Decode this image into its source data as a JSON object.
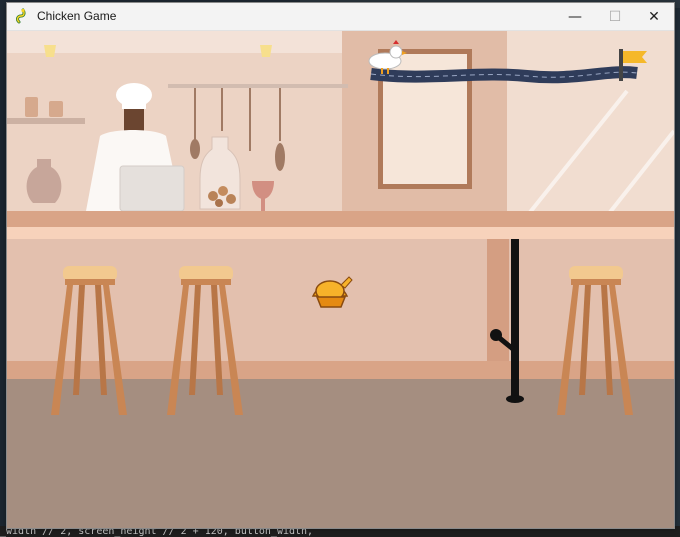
{
  "window": {
    "title": "Chicken Game",
    "minimize_glyph": "—",
    "maximize_glyph": "☐",
    "close_glyph": "✕"
  },
  "background_code": {
    "bottom_line": "_width // 2, screen_height // 2 + 120, button_width,"
  },
  "game": {
    "scene": "kitchen-bar",
    "sprites": [
      "chicken-icon",
      "finish-flag-icon",
      "roast-chicken-icon",
      "chef-figure"
    ],
    "colors": {
      "wall": "#ecd3c4",
      "counter": "#d9a487",
      "bar_front": "#e3c0ae",
      "floor": "#a58e80",
      "stool": "#c98654",
      "road": "#2f3c5a",
      "flag": "#f5b82a"
    }
  }
}
